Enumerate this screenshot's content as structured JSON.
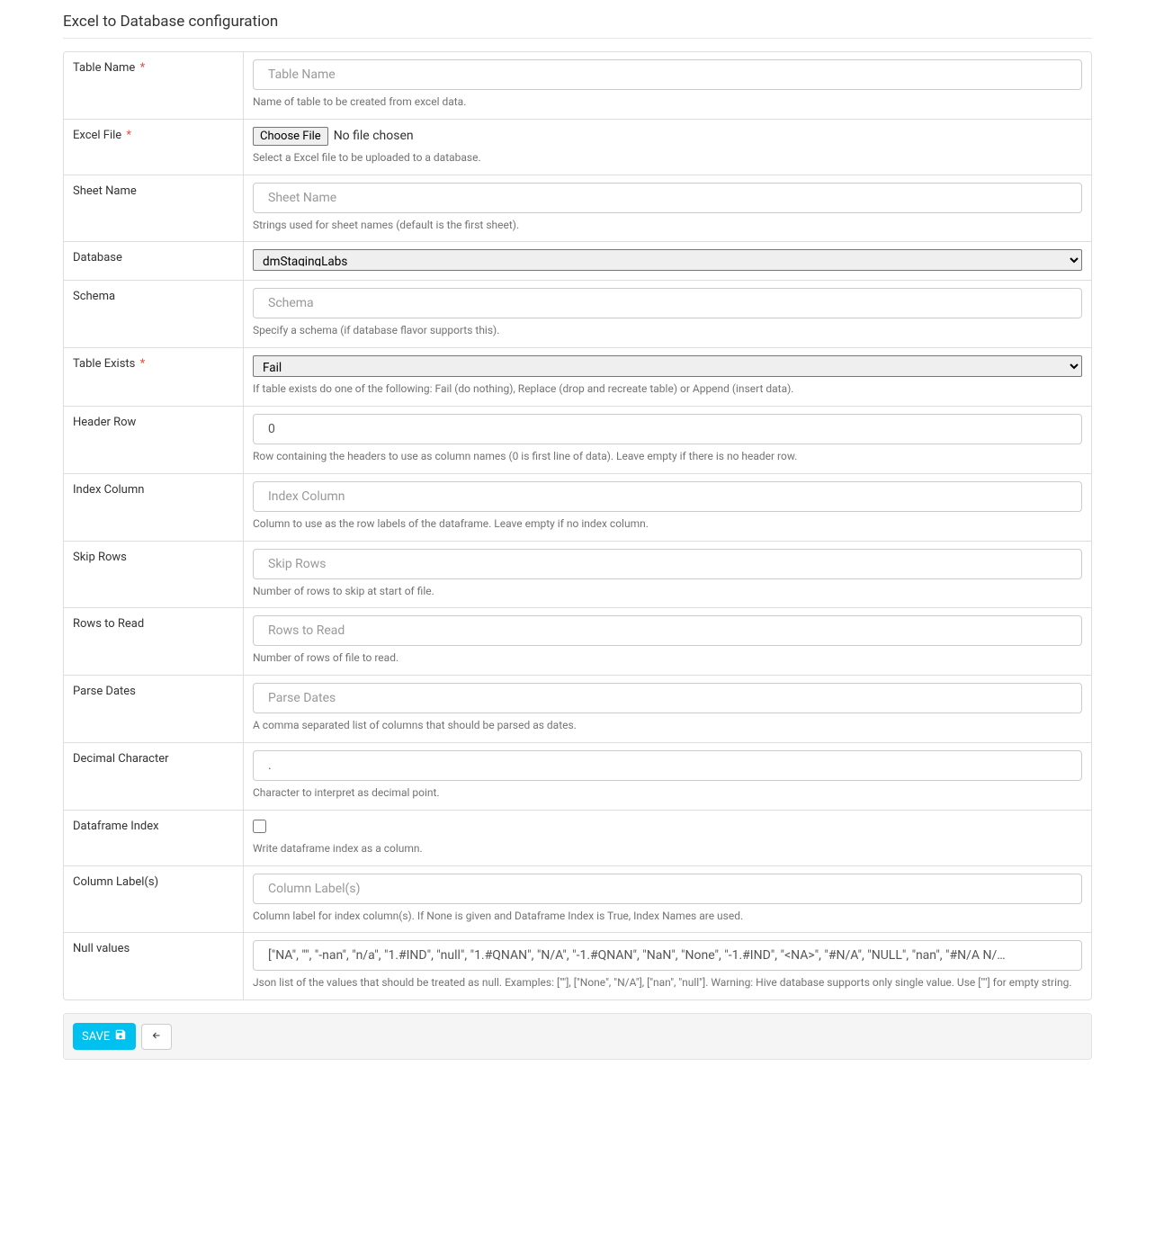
{
  "title": "Excel to Database configuration",
  "fields": {
    "table_name": {
      "label": "Table Name",
      "placeholder": "Table Name",
      "value": "",
      "help": "Name of table to be created from excel data."
    },
    "excel_file": {
      "label": "Excel File",
      "button": "Choose File",
      "status": "No file chosen",
      "help": "Select a Excel file to be uploaded to a database."
    },
    "sheet_name": {
      "label": "Sheet Name",
      "placeholder": "Sheet Name",
      "value": "",
      "help": "Strings used for sheet names (default is the first sheet)."
    },
    "database": {
      "label": "Database",
      "value": "dmStagingLabs"
    },
    "schema": {
      "label": "Schema",
      "placeholder": "Schema",
      "value": "",
      "help": "Specify a schema (if database flavor supports this)."
    },
    "table_exists": {
      "label": "Table Exists",
      "value": "Fail",
      "help": "If table exists do one of the following: Fail (do nothing), Replace (drop and recreate table) or Append (insert data)."
    },
    "header_row": {
      "label": "Header Row",
      "placeholder": "",
      "value": "0",
      "help": "Row containing the headers to use as column names (0 is first line of data). Leave empty if there is no header row."
    },
    "index_column": {
      "label": "Index Column",
      "placeholder": "Index Column",
      "value": "",
      "help": "Column to use as the row labels of the dataframe. Leave empty if no index column."
    },
    "skip_rows": {
      "label": "Skip Rows",
      "placeholder": "Skip Rows",
      "value": "",
      "help": "Number of rows to skip at start of file."
    },
    "rows_to_read": {
      "label": "Rows to Read",
      "placeholder": "Rows to Read",
      "value": "",
      "help": "Number of rows of file to read."
    },
    "parse_dates": {
      "label": "Parse Dates",
      "placeholder": "Parse Dates",
      "value": "",
      "help": "A comma separated list of columns that should be parsed as dates."
    },
    "decimal_char": {
      "label": "Decimal Character",
      "placeholder": "",
      "value": ".",
      "help": "Character to interpret as decimal point."
    },
    "dataframe_index": {
      "label": "Dataframe Index",
      "help": "Write dataframe index as a column."
    },
    "column_labels": {
      "label": "Column Label(s)",
      "placeholder": "Column Label(s)",
      "value": "",
      "help": "Column label for index column(s). If None is given and Dataframe Index is True, Index Names are used."
    },
    "null_values": {
      "label": "Null values",
      "value": "[\"NA\", \"\", \"-nan\", \"n/a\", \"1.#IND\", \"null\", \"1.#QNAN\", \"N/A\", \"-1.#QNAN\", \"NaN\", \"None\", \"-1.#IND\", \"<NA>\", \"#N/A\", \"NULL\", \"nan\", \"#N/A N/…",
      "help": "Json list of the values that should be treated as null. Examples: [\"\"], [\"None\", \"N/A\"], [\"nan\", \"null\"]. Warning: Hive database supports only single value. Use [\"\"] for empty string."
    }
  },
  "footer": {
    "save_label": "SAVE"
  }
}
